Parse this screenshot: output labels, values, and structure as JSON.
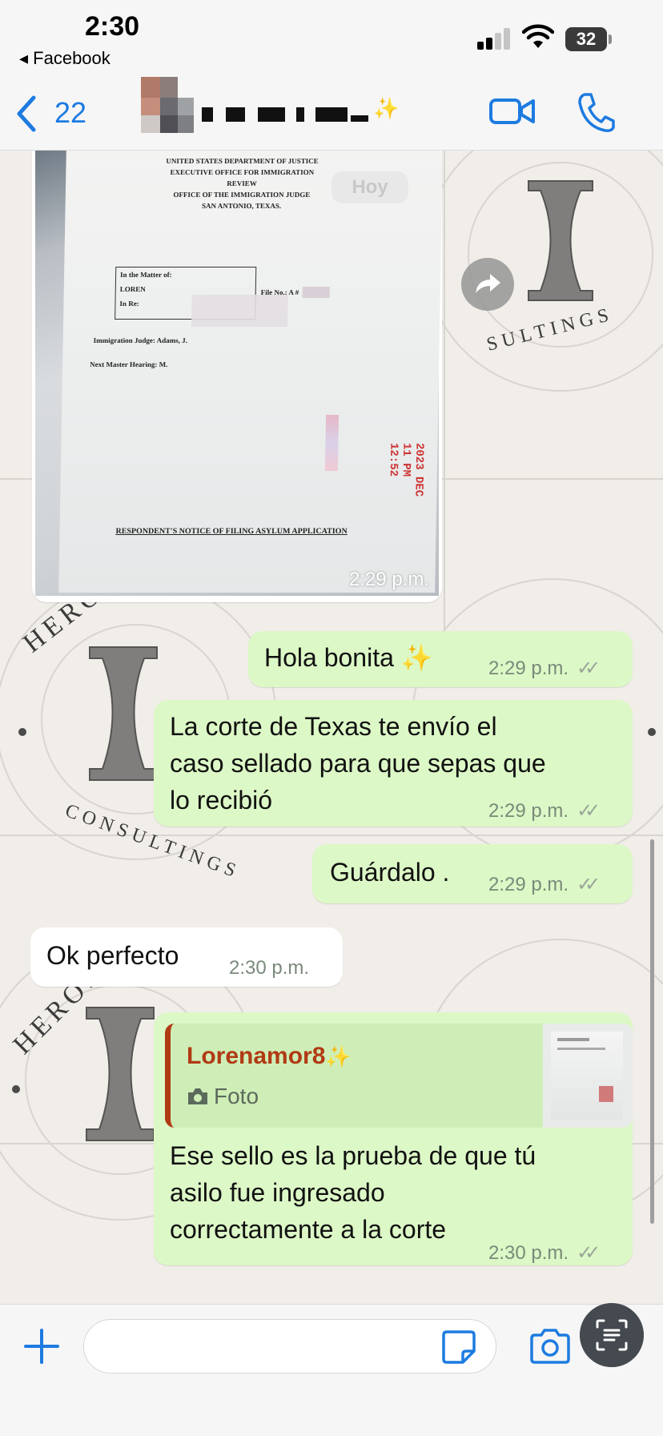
{
  "status_bar": {
    "time": "2:30",
    "back_app": "◂ Facebook",
    "battery": "32"
  },
  "header": {
    "back_count": "22",
    "video_call_icon": "video-camera-icon",
    "phone_call_icon": "phone-icon"
  },
  "image_message": {
    "date_pill": "Hoy",
    "time": "2:29 p.m.",
    "doc_header": [
      "UNITED STATES DEPARTMENT OF JUSTICE",
      "EXECUTIVE OFFICE FOR IMMIGRATION REVIEW",
      "OFFICE OF THE IMMIGRATION JUDGE",
      "SAN ANTONIO, TEXAS."
    ],
    "doc_matter": "In the Matter of:",
    "doc_name": "LOREN",
    "doc_in_re": "In Re:",
    "doc_file_no": "File No.: A #",
    "doc_judge": "Immigration Judge: Adams, J.",
    "doc_hearing": "Next Master Hearing: M.",
    "doc_footer": "RESPONDENT'S NOTICE OF FILING ASYLUM APPLICATION",
    "doc_stamp": "2023 DEC 11 PM 12:52"
  },
  "messages": [
    {
      "text": "Hola bonita ✨",
      "time": "2:29 p.m.",
      "direction": "out"
    },
    {
      "text_lines": [
        "La corte de Texas te envío el",
        "caso sellado para que sepas que",
        "lo recibió"
      ],
      "time": "2:29 p.m.",
      "direction": "out"
    },
    {
      "text": "Guárdalo .",
      "time": "2:29 p.m.",
      "direction": "out"
    },
    {
      "text": "Ok perfecto",
      "time": "2:30 p.m.",
      "direction": "in"
    },
    {
      "reply_to": {
        "name": "Lorenamor8",
        "type": "Foto"
      },
      "text_lines": [
        "Ese sello es la prueba de que tú",
        "asilo fue ingresado",
        "correctamente a la corte"
      ],
      "time": "2:30 p.m.",
      "direction": "out"
    }
  ],
  "wallpaper": {
    "brand_top": "HEROS GROUP",
    "brand_bottom": "CONSULTINGS"
  },
  "input": {
    "value": "",
    "placeholder": ""
  },
  "colors": {
    "accent": "#1d7be0",
    "outgoing_bubble": "#dcf8c6",
    "incoming_bubble": "#ffffff",
    "reply_name": "#b03a14"
  }
}
